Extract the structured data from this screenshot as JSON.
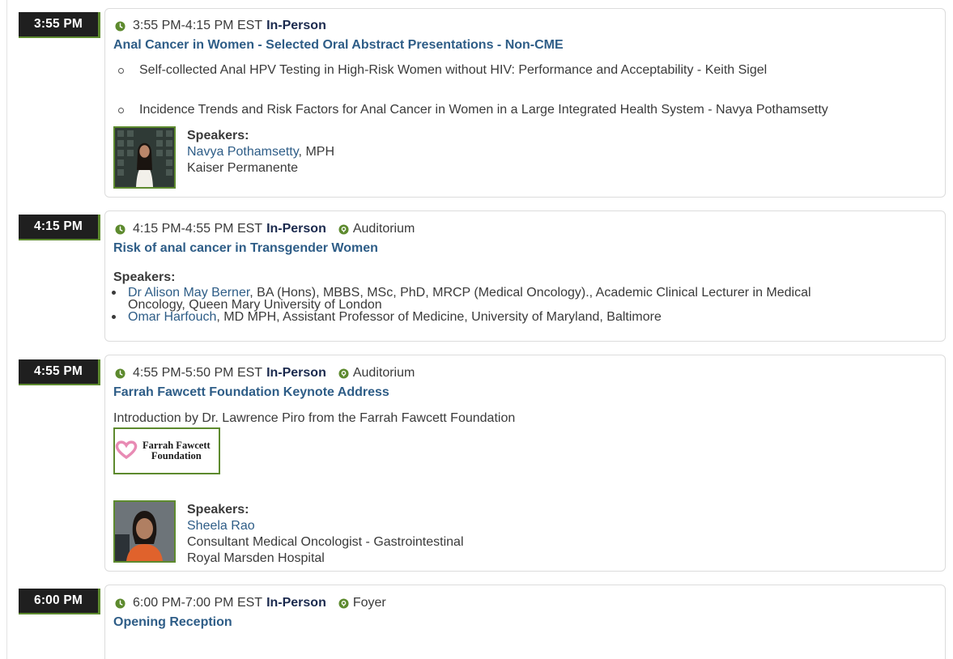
{
  "colors": {
    "accent_green": "#5d8a2e",
    "title_blue": "#2e5d87",
    "badge_bg": "#1f1f1f",
    "inperson_navy": "#1b2a4e"
  },
  "sessions": [
    {
      "badge": "3:55 PM",
      "time": "3:55 PM-4:15 PM EST",
      "mode": "In-Person",
      "title": "Anal Cancer in Women - Selected Oral Abstract Presentations - Non-CME",
      "abstracts": [
        "Self-collected Anal HPV Testing in High-Risk Women without HIV: Performance and Acceptability - Keith Sigel",
        "Incidence Trends and Risk Factors for Anal Cancer in Women in a Large Integrated Health System - Navya Pothamsetty"
      ],
      "speakers_label": "Speakers:",
      "speaker": {
        "name": "Navya Pothamsetty",
        "credentials": ", MPH",
        "org": "Kaiser Permanente"
      }
    },
    {
      "badge": "4:15 PM",
      "time": "4:15 PM-4:55 PM EST",
      "mode": "In-Person",
      "location": "Auditorium",
      "title": "Risk of anal cancer in Transgender Women",
      "speakers_label": "Speakers:",
      "speakers": [
        {
          "name": "Dr Alison May Berner",
          "details_line1": ", BA (Hons), MBBS, MSc, PhD, MRCP (Medical Oncology)., Academic Clinical Lecturer in Medical",
          "details_line2": "Oncology, Queen Mary University of London"
        },
        {
          "name": "Omar Harfouch",
          "details_line1": ", MD MPH, Assistant Professor of Medicine, University of Maryland, Baltimore"
        }
      ]
    },
    {
      "badge": "4:55 PM",
      "time": "4:55 PM-5:50 PM EST",
      "mode": "In-Person",
      "location": "Auditorium",
      "title": "Farrah Fawcett Foundation Keynote Address",
      "description": "Introduction by Dr. Lawrence Piro from the Farrah Fawcett Foundation",
      "logo_line1": "Farrah Fawcett",
      "logo_line2": "Foundation",
      "speakers_label": "Speakers:",
      "speaker": {
        "name": "Sheela Rao",
        "role": "Consultant Medical Oncologist - Gastrointestinal",
        "org": "Royal Marsden Hospital"
      }
    },
    {
      "badge": "6:00 PM",
      "time": "6:00 PM-7:00 PM EST",
      "mode": "In-Person",
      "location": "Foyer",
      "title": "Opening Reception"
    }
  ]
}
